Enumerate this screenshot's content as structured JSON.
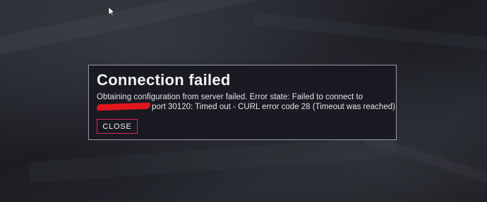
{
  "dialog": {
    "title": "Connection failed",
    "message_line1": "Obtaining configuration from server failed. Error state: Failed to connect to",
    "message_line2": "port 30120: Timed out - CURL error code 28 (Timeout was reached)",
    "close_label": "CLOSE"
  },
  "colors": {
    "accent": "#e0245e",
    "dialog_border": "#9a9ba3",
    "dialog_background": "#181921",
    "redaction": "#e3161c"
  },
  "icons": {
    "cursor": "mouse-pointer-icon"
  }
}
